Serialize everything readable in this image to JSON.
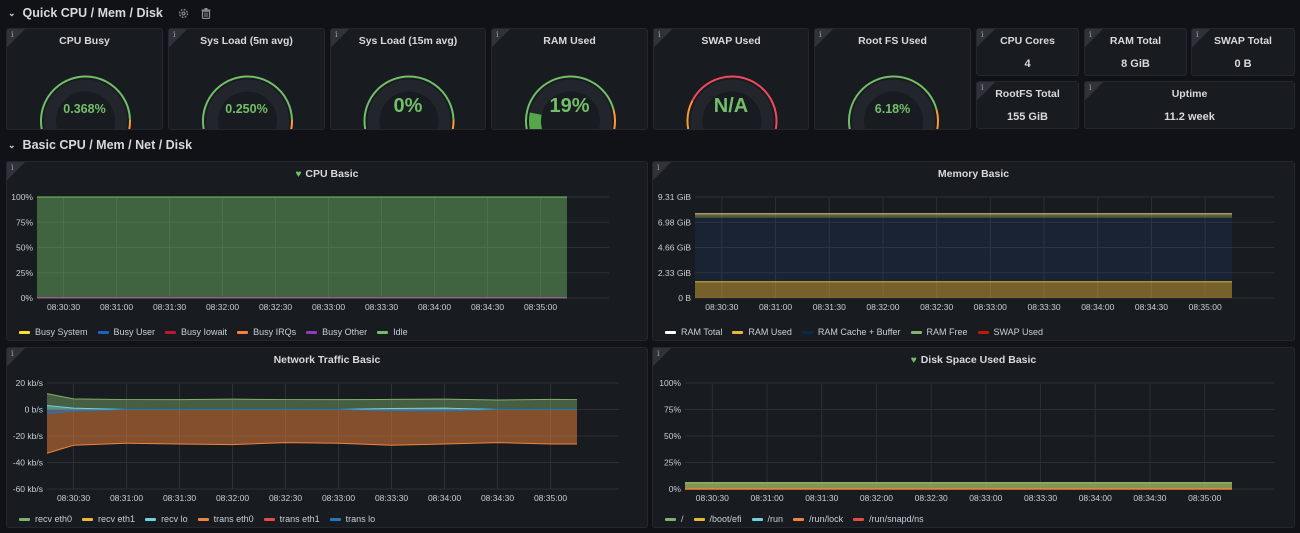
{
  "rows": [
    {
      "title": "Quick CPU / Mem / Disk",
      "collapsed": false,
      "icons": [
        "gear-icon",
        "trash-icon"
      ]
    },
    {
      "title": "Basic CPU / Mem / Net / Disk",
      "collapsed": false
    }
  ],
  "gauges": [
    {
      "title": "CPU Busy",
      "value_text": "0.368%",
      "fraction": 0.00368,
      "thresholds": [
        {
          "to": 0.85,
          "color": "#73bf69"
        },
        {
          "to": 0.95,
          "color": "#ff9830"
        },
        {
          "to": 1.0,
          "color": "#f2495c"
        }
      ]
    },
    {
      "title": "Sys Load (5m avg)",
      "value_text": "0.250%",
      "fraction": 0.0025,
      "thresholds": [
        {
          "to": 0.85,
          "color": "#73bf69"
        },
        {
          "to": 0.95,
          "color": "#ff9830"
        },
        {
          "to": 1.0,
          "color": "#f2495c"
        }
      ]
    },
    {
      "title": "Sys Load (15m avg)",
      "value_text": "0%",
      "fraction": 0.0,
      "thresholds": [
        {
          "to": 0.85,
          "color": "#73bf69"
        },
        {
          "to": 0.95,
          "color": "#ff9830"
        },
        {
          "to": 1.0,
          "color": "#f2495c"
        }
      ]
    },
    {
      "title": "RAM Used",
      "value_text": "19%",
      "fraction": 0.19,
      "thresholds": [
        {
          "to": 0.8,
          "color": "#73bf69"
        },
        {
          "to": 0.9,
          "color": "#ff9830"
        },
        {
          "to": 1.0,
          "color": "#f2495c"
        }
      ]
    },
    {
      "title": "SWAP Used",
      "value_text": "N/A",
      "fraction": 0.0,
      "thresholds": [
        {
          "to": 0.1,
          "color": "#73bf69"
        },
        {
          "to": 0.25,
          "color": "#ff9830"
        },
        {
          "to": 1.0,
          "color": "#f2495c"
        }
      ]
    },
    {
      "title": "Root FS Used",
      "value_text": "6.18%",
      "fraction": 0.0618,
      "thresholds": [
        {
          "to": 0.8,
          "color": "#73bf69"
        },
        {
          "to": 0.9,
          "color": "#ff9830"
        },
        {
          "to": 1.0,
          "color": "#f2495c"
        }
      ]
    }
  ],
  "stats": [
    {
      "title": "CPU Cores",
      "value": "4"
    },
    {
      "title": "RAM Total",
      "value": "8 GiB"
    },
    {
      "title": "SWAP Total",
      "value": "0 B"
    },
    {
      "title": "RootFS Total",
      "value": "155 GiB"
    },
    {
      "title": "Uptime",
      "value": "11.2 week"
    }
  ],
  "chart_data": [
    {
      "type": "area",
      "title": "CPU Basic",
      "title_icon": "heart-icon",
      "stacked": true,
      "x": [
        "08:30:15",
        "08:30:30",
        "08:31:00",
        "08:31:30",
        "08:32:00",
        "08:32:30",
        "08:33:00",
        "08:33:30",
        "08:34:00",
        "08:34:30",
        "08:35:00",
        "08:35:15"
      ],
      "xticks": [
        "08:30:30",
        "08:31:00",
        "08:31:30",
        "08:32:00",
        "08:32:30",
        "08:33:00",
        "08:33:30",
        "08:34:00",
        "08:34:30",
        "08:35:00"
      ],
      "yticks": [
        "0%",
        "25%",
        "50%",
        "75%",
        "100%"
      ],
      "ylim": [
        0,
        100
      ],
      "series": [
        {
          "name": "Busy System",
          "color": "#fade2a",
          "values": [
            0.2,
            0.2,
            0.2,
            0.2,
            0.2,
            0.2,
            0.2,
            0.2,
            0.2,
            0.2,
            0.2,
            0.2
          ]
        },
        {
          "name": "Busy User",
          "color": "#1f60c4",
          "values": [
            0.15,
            0.15,
            0.15,
            0.15,
            0.15,
            0.15,
            0.15,
            0.15,
            0.15,
            0.15,
            0.15,
            0.15
          ]
        },
        {
          "name": "Busy Iowait",
          "color": "#c4162a",
          "values": [
            0,
            0,
            0,
            0,
            0,
            0,
            0,
            0,
            0,
            0,
            0,
            0
          ]
        },
        {
          "name": "Busy IRQs",
          "color": "#ff7f38",
          "values": [
            0,
            0,
            0,
            0,
            0,
            0,
            0,
            0,
            0,
            0,
            0,
            0
          ]
        },
        {
          "name": "Busy Other",
          "color": "#8f3bb8",
          "values": [
            0,
            0,
            0,
            0,
            0,
            0,
            0,
            0,
            0,
            0,
            0,
            0
          ]
        },
        {
          "name": "Idle",
          "color": "#73bf69",
          "values": [
            99.65,
            99.65,
            99.65,
            99.65,
            99.65,
            99.65,
            99.65,
            99.65,
            99.65,
            99.65,
            99.65,
            99.65
          ]
        }
      ]
    },
    {
      "type": "area",
      "title": "Memory Basic",
      "stacked": true,
      "x": [
        "08:30:15",
        "08:30:30",
        "08:31:00",
        "08:31:30",
        "08:32:00",
        "08:32:30",
        "08:33:00",
        "08:33:30",
        "08:34:00",
        "08:34:30",
        "08:35:00",
        "08:35:15"
      ],
      "xticks": [
        "08:30:30",
        "08:31:00",
        "08:31:30",
        "08:32:00",
        "08:32:30",
        "08:33:00",
        "08:33:30",
        "08:34:00",
        "08:34:30",
        "08:35:00"
      ],
      "yticks": [
        "0 B",
        "2.33 GiB",
        "4.66 GiB",
        "6.98 GiB",
        "9.31 GiB"
      ],
      "ylim": [
        0,
        9.31
      ],
      "unit": "GiB",
      "series": [
        {
          "name": "RAM Total",
          "color": "#ffffff",
          "values": [
            7.77,
            7.77,
            7.77,
            7.77,
            7.77,
            7.77,
            7.77,
            7.77,
            7.77,
            7.77,
            7.77,
            7.77
          ]
        },
        {
          "name": "RAM Used",
          "color": "#eab839",
          "values": [
            1.5,
            1.5,
            1.5,
            1.5,
            1.5,
            1.5,
            1.5,
            1.5,
            1.5,
            1.5,
            1.5,
            1.5
          ]
        },
        {
          "name": "RAM Cache + Buffer",
          "color": "#052b51",
          "values": [
            5.9,
            5.9,
            5.9,
            5.9,
            5.9,
            5.9,
            5.9,
            5.9,
            5.9,
            5.9,
            5.9,
            5.9
          ]
        },
        {
          "name": "RAM Free",
          "color": "#7eb26d",
          "values": [
            0.2,
            0.2,
            0.2,
            0.2,
            0.2,
            0.2,
            0.2,
            0.2,
            0.2,
            0.2,
            0.2,
            0.2
          ]
        },
        {
          "name": "SWAP Used",
          "color": "#bf1b00",
          "values": [
            0,
            0,
            0,
            0,
            0,
            0,
            0,
            0,
            0,
            0,
            0,
            0
          ]
        }
      ]
    },
    {
      "type": "area",
      "title": "Network Traffic Basic",
      "stacked": false,
      "x": [
        "08:30:15",
        "08:30:30",
        "08:31:00",
        "08:31:30",
        "08:32:00",
        "08:32:30",
        "08:33:00",
        "08:33:30",
        "08:34:00",
        "08:34:30",
        "08:35:00",
        "08:35:15"
      ],
      "xticks": [
        "08:30:30",
        "08:31:00",
        "08:31:30",
        "08:32:00",
        "08:32:30",
        "08:33:00",
        "08:33:30",
        "08:34:00",
        "08:34:30",
        "08:35:00"
      ],
      "yticks": [
        "-60 kb/s",
        "-40 kb/s",
        "-20 kb/s",
        "0 b/s",
        "20 kb/s"
      ],
      "ylim": [
        -60,
        20
      ],
      "unit": "kb/s",
      "series": [
        {
          "name": "recv eth0",
          "color": "#7eb26d",
          "values": [
            12,
            8,
            7.5,
            7.5,
            7.8,
            7.5,
            7.5,
            7.6,
            7.8,
            7.2,
            7.6,
            7.5
          ]
        },
        {
          "name": "recv eth1",
          "color": "#eab839",
          "values": [
            0,
            0,
            0,
            0,
            0,
            0,
            0,
            0,
            0,
            0,
            0,
            0
          ]
        },
        {
          "name": "recv lo",
          "color": "#6ed0e0",
          "values": [
            3,
            1,
            0,
            0,
            0,
            0,
            0,
            0.8,
            1,
            0,
            0,
            0
          ]
        },
        {
          "name": "trans eth0",
          "color": "#ef843c",
          "values": [
            -33,
            -27,
            -25.5,
            -26,
            -26.5,
            -25,
            -25.5,
            -27,
            -26,
            -25,
            -26,
            -26
          ]
        },
        {
          "name": "trans eth1",
          "color": "#e24d42",
          "values": [
            0,
            0,
            0,
            0,
            0,
            0,
            0,
            0,
            0,
            0,
            0,
            0
          ]
        },
        {
          "name": "trans lo",
          "color": "#1f78c1",
          "values": [
            -3,
            -1,
            0,
            0,
            0,
            0,
            0,
            -0.8,
            -1,
            0,
            0,
            0
          ]
        }
      ]
    },
    {
      "type": "area",
      "title": "Disk Space Used Basic",
      "title_icon": "heart-icon",
      "stacked": false,
      "x": [
        "08:30:15",
        "08:30:30",
        "08:31:00",
        "08:31:30",
        "08:32:00",
        "08:32:30",
        "08:33:00",
        "08:33:30",
        "08:34:00",
        "08:34:30",
        "08:35:00",
        "08:35:15"
      ],
      "xticks": [
        "08:30:30",
        "08:31:00",
        "08:31:30",
        "08:32:00",
        "08:32:30",
        "08:33:00",
        "08:33:30",
        "08:34:00",
        "08:34:30",
        "08:35:00"
      ],
      "yticks": [
        "0%",
        "25%",
        "50%",
        "75%",
        "100%"
      ],
      "ylim": [
        0,
        100
      ],
      "series": [
        {
          "name": "/",
          "color": "#7eb26d",
          "values": [
            6.18,
            6.18,
            6.18,
            6.18,
            6.18,
            6.18,
            6.18,
            6.18,
            6.18,
            6.18,
            6.18,
            6.18
          ]
        },
        {
          "name": "/boot/efi",
          "color": "#eab839",
          "values": [
            5.8,
            5.8,
            5.8,
            5.8,
            5.8,
            5.8,
            5.8,
            5.8,
            5.8,
            5.8,
            5.8,
            5.8
          ]
        },
        {
          "name": "/run",
          "color": "#6ed0e0",
          "values": [
            0.3,
            0.3,
            0.3,
            0.3,
            0.3,
            0.3,
            0.3,
            0.3,
            0.3,
            0.3,
            0.3,
            0.3
          ]
        },
        {
          "name": "/run/lock",
          "color": "#ef843c",
          "values": [
            0,
            0,
            0,
            0,
            0,
            0,
            0,
            0,
            0,
            0,
            0,
            0
          ]
        },
        {
          "name": "/run/snapd/ns",
          "color": "#e24d42",
          "values": [
            0,
            0,
            0,
            0,
            0,
            0,
            0,
            0,
            0,
            0,
            0,
            0
          ]
        }
      ]
    }
  ]
}
